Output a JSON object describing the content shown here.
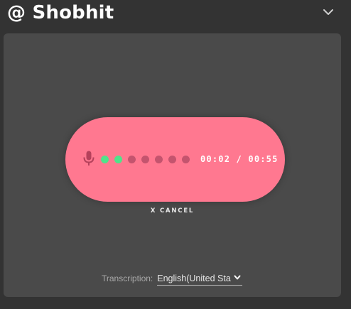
{
  "header": {
    "title": "@ Shobhit",
    "collapse_icon": "chevron-down-icon"
  },
  "recorder": {
    "mic_icon": "microphone-icon",
    "timer": "00:02 / 00:55",
    "progress": {
      "total_dots": 7,
      "active_dots": 2
    },
    "colors": {
      "pill": "#ff7890",
      "dot_active": "#4fe38a",
      "dot_inactive": "#c4546e",
      "mic": "#b5415b"
    },
    "cancel_label": "X CANCEL"
  },
  "transcription": {
    "label": "Transcription:",
    "selected_language": "English(United Sta"
  }
}
